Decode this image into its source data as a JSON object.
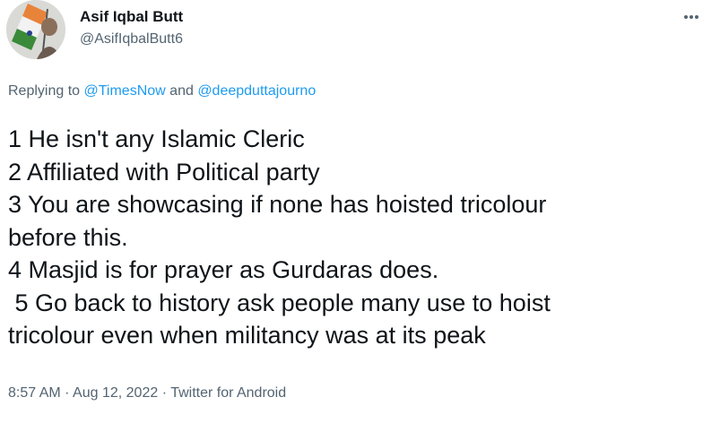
{
  "author": {
    "display_name": "Asif Iqbal Butt",
    "handle": "@AsifIqbalButt6"
  },
  "reply": {
    "prefix": "Replying to ",
    "mention_1": "@TimesNow",
    "conjunction": " and ",
    "mention_2": "@deepduttajourno"
  },
  "tweet_lines": [
    "1 He isn't any Islamic Cleric",
    "2 Affiliated with Political party",
    "3 You are showcasing if none has hoisted tricolour",
    "before this.",
    "4 Masjid is for prayer as Gurdaras does.",
    " 5 Go back to history ask people many use to hoist",
    "tricolour even when militancy was at its peak"
  ],
  "meta": {
    "time": "8:57 AM",
    "separator_1": " · ",
    "date": "Aug 12, 2022",
    "separator_2": " · ",
    "source": "Twitter for Android"
  },
  "icons": {
    "more": "more-options-icon"
  },
  "colors": {
    "text": "#0f1419",
    "secondary": "#536471",
    "link": "#1d9bf0"
  }
}
